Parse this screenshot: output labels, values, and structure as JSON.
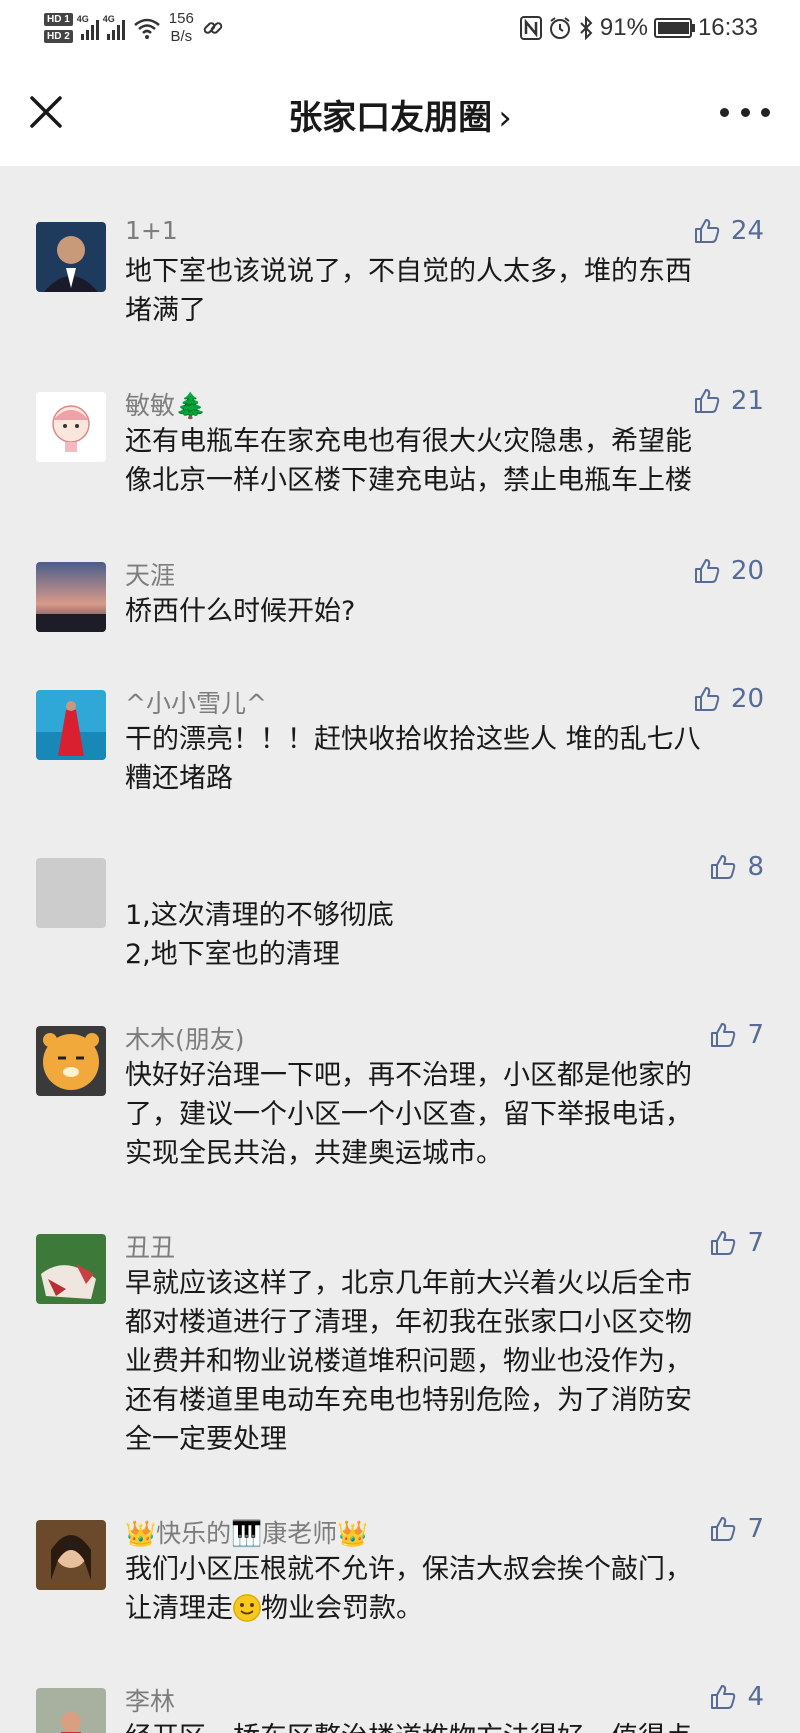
{
  "status_bar": {
    "hd1": "HD 1",
    "hd2": "HD 2",
    "net1": "4G",
    "net2": "4G",
    "speed_value": "156",
    "speed_unit": "B/s",
    "battery": "91%",
    "time": "16:33"
  },
  "header": {
    "title": "张家口友朋圈",
    "chevron": "›"
  },
  "comments": [
    {
      "name": "1+1",
      "likes": "24",
      "text": "地下室也该说说了，不自觉的人太多，堆的东西\n堵满了"
    },
    {
      "name": "敏敏🌲",
      "likes": "21",
      "text": "还有电瓶车在家充电也有很大火灾隐患，希望能\n像北京一样小区楼下建充电站，禁止电瓶车上楼"
    },
    {
      "name": "天涯",
      "likes": "20",
      "text": "桥西什么时候开始?"
    },
    {
      "name": "^小小雪儿^",
      "likes": "20",
      "text": "干的漂亮！！！赶快收拾收拾这些人 堆的乱七八\n糟还堵路"
    },
    {
      "name": "",
      "likes": "8",
      "text": "1,这次清理的不够彻底\n2,地下室也的清理"
    },
    {
      "name": "木木(朋友)",
      "likes": "7",
      "text": "快好好治理一下吧，再不治理，小区都是他家的\n了，建议一个小区一个小区查，留下举报电话，\n实现全民共治，共建奥运城市。"
    },
    {
      "name": "丑丑",
      "likes": "7",
      "text": "早就应该这样了，北京几年前大兴着火以后全市\n都对楼道进行了清理，年初我在张家口小区交物\n业费并和物业说楼道堆积问题，物业也没作为，\n还有楼道里电动车充电也特别危险，为了消防安\n全一定要处理"
    },
    {
      "name": "👑快乐的🎹康老师👑",
      "likes": "7",
      "text_before": "我们小区压根就不允许，保洁大叔会挨个敲门，\n让清理走",
      "text_after": "物业会罚款。"
    },
    {
      "name": "李林",
      "likes": "4",
      "text": "经开区，桥东区整治楼道堆物方法得好，值得点"
    }
  ],
  "colors": {
    "link": "#576b95",
    "name": "#7d7d7d",
    "background": "#ededed"
  },
  "icons": [
    "close-icon",
    "more-icon",
    "thumbs-up-icon",
    "wifi-icon",
    "link-icon",
    "nfc-icon",
    "alarm-icon",
    "bluetooth-icon",
    "battery-icon"
  ]
}
